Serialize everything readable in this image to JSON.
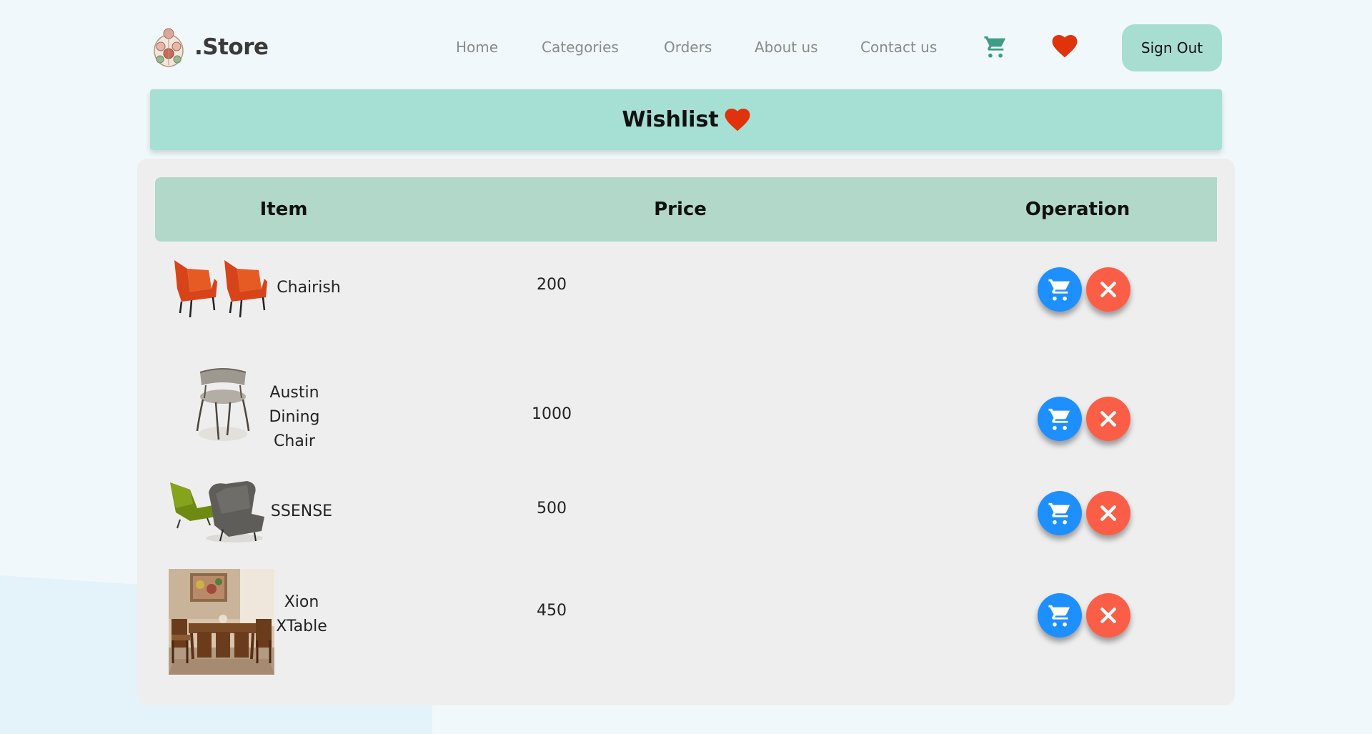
{
  "brand": {
    "name": ".Store"
  },
  "nav": {
    "links": [
      "Home",
      "Categories",
      "Orders",
      "About us",
      "Contact us"
    ],
    "cart_icon": "cart-icon",
    "wishlist_icon": "heart-icon",
    "sign_out": "Sign Out"
  },
  "banner": {
    "title": "Wishlist",
    "icon": "heart-icon"
  },
  "table": {
    "headers": [
      "Item",
      "Price",
      "Operation"
    ],
    "rows": [
      {
        "name": "Chairish",
        "price": "200",
        "image": "orange-armchairs"
      },
      {
        "name": "Austin\nDining\nChair",
        "price": "1000",
        "image": "grey-dining-chair"
      },
      {
        "name": "SSENSE",
        "price": "500",
        "image": "green-grey-lounge-chairs"
      },
      {
        "name": "Xion\nXTable",
        "price": "450",
        "image": "dining-table-set"
      }
    ],
    "operations": {
      "add_to_cart_icon": "cart-icon",
      "remove_icon": "close-icon"
    }
  },
  "colors": {
    "accent": "#a6dfd3",
    "header_row": "#b2d8ca",
    "cart_button": "#1e8fff",
    "remove_button": "#fb5e47",
    "heart": "#e0330c",
    "nav_cart": "#3f9c87"
  }
}
